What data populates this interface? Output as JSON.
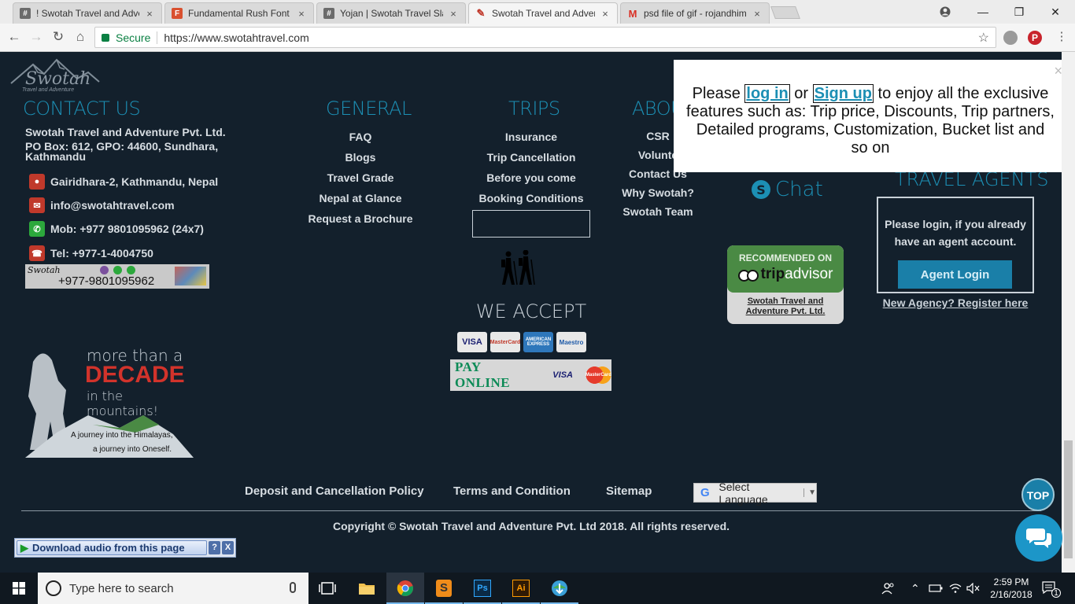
{
  "browser": {
    "tabs": [
      {
        "title": "! Swotah Travel and Adve",
        "favicon": "hash-icon",
        "color": "#6b6b6b"
      },
      {
        "title": "Fundamental Rush Font",
        "favicon": "font-icon",
        "color": "#d9502f"
      },
      {
        "title": "Yojan | Swotah Travel Sla",
        "favicon": "hash-icon",
        "color": "#6b6b6b"
      },
      {
        "title": "Swotah Travel and Adven",
        "favicon": "swotah-icon",
        "color": "#c0392b"
      },
      {
        "title": "psd file of gif - rojandhim",
        "favicon": "gmail-icon",
        "color": "#d93025"
      }
    ],
    "close_glyph": "×",
    "secure_label": "Secure",
    "url": "https://www.swotahtravel.com"
  },
  "site": {
    "logo_text": "Swotah",
    "logo_sub": "Travel and Adventure",
    "contact": {
      "heading": "CONTACT US",
      "company": "Swotah Travel and Adventure Pvt. Ltd.",
      "po_box": "PO Box: 612, GPO: 44600, Sundhara, Kathmandu",
      "address": "Gairidhara-2, Kathmandu, Nepal",
      "email": "info@swotahtravel.com",
      "mobile": "Mob: +977 9801095962 (24x7)",
      "tel": "Tel: +977-1-4004750",
      "banner_brand": "Swotah",
      "banner_phone": "+977-9801095962"
    },
    "decade": {
      "line1": "more than a",
      "line2": "DECADE",
      "line3": "in the mountains!",
      "tag1": "A journey into the Himalayas,",
      "tag2": "a journey into Oneself."
    },
    "general": {
      "heading": "GENERAL",
      "items": [
        "FAQ",
        "Blogs",
        "Travel Grade",
        "Nepal at Glance",
        "Request a Brochure"
      ]
    },
    "trips": {
      "heading": "TRIPS",
      "items": [
        "Insurance",
        "Trip Cancellation",
        "Before you come",
        "Booking Conditions"
      ]
    },
    "about": {
      "heading": "ABOU",
      "items": [
        "CSR",
        "Volunte",
        "Contact Us",
        "Why Swotah?",
        "Swotah Team"
      ]
    },
    "we_accept": "WE ACCEPT",
    "cards": [
      {
        "label": "VISA",
        "bg": "#e9e9e9",
        "fg": "#1a1f71"
      },
      {
        "label": "MasterCard",
        "bg": "#e8e8e8",
        "fg": "#c0392b"
      },
      {
        "label": "AMERICAN EXPRESS",
        "bg": "#2e77bb",
        "fg": "#ffffff"
      },
      {
        "label": "Maestro",
        "bg": "#e8e8e8",
        "fg": "#1e5aa8"
      }
    ],
    "pay_online": "PAY ONLINE",
    "pay_visa": "VISA",
    "pay_mc": "MasterCard",
    "chat": "Chat",
    "tripadvisor": {
      "recommended": "RECOMMENDED ON",
      "brand_trip": "trip",
      "brand_advisor": "advisor",
      "company": "Swotah Travel and Adventure Pvt. Ltd."
    },
    "agents": {
      "heading": "TRAVEL AGENTS",
      "text": "Please login, if you already have an agent account.",
      "button": "Agent Login",
      "register": "New Agency? Register here"
    },
    "popup": {
      "before": "Please",
      "login": "log in",
      "or": "or",
      "signup": "Sign up",
      "after": "to enjoy all the exclusive features such as: Trip price, Discounts, Trip partners, Detailed programs, Customization, Bucket list and so on",
      "close": "×"
    },
    "bottom_links": [
      "Deposit and Cancellation Policy",
      "Terms and Condition",
      "Sitemap"
    ],
    "language": "Select Language",
    "copyright": "Copyright © Swotah Travel and Adventure Pvt. Ltd 2018. All rights reserved.",
    "top_button": "TOP"
  },
  "audio_bar": {
    "label": "Download audio from this page",
    "help": "?",
    "close": "X"
  },
  "taskbar": {
    "search_placeholder": "Type here to search",
    "time": "2:59 PM",
    "date": "2/16/2018",
    "notifications": "1"
  }
}
